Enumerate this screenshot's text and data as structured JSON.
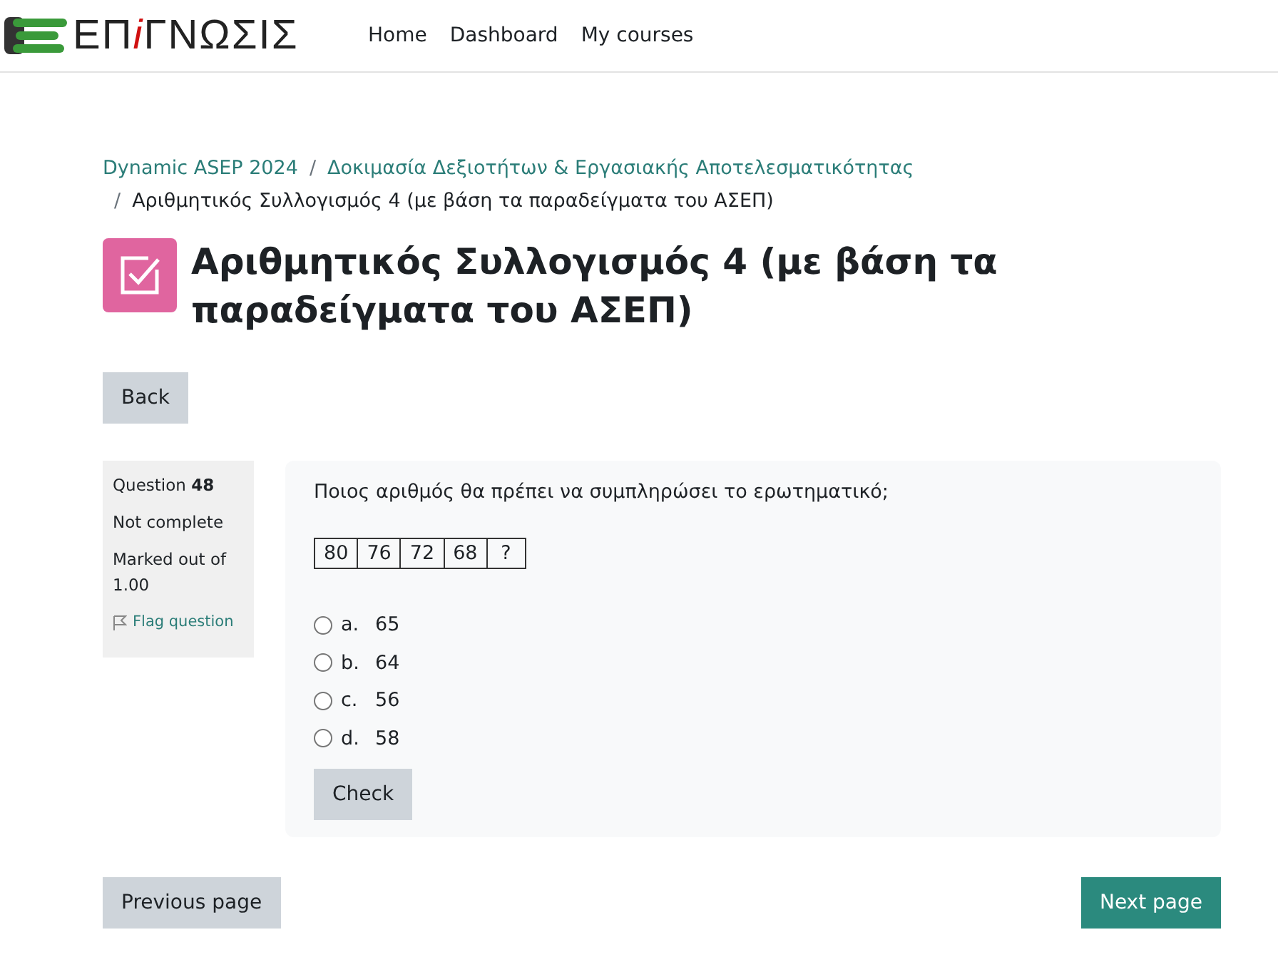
{
  "logo": {
    "parts": [
      {
        "text": "ΕΠ",
        "accent": false
      },
      {
        "text": "i",
        "accent": true
      },
      {
        "text": "ΓΝΩΣΙΣ",
        "accent": false
      }
    ]
  },
  "nav": [
    {
      "label": "Home"
    },
    {
      "label": "Dashboard"
    },
    {
      "label": "My courses"
    }
  ],
  "breadcrumb": [
    {
      "label": "Dynamic ASEP 2024",
      "kind": "link"
    },
    {
      "separator": "/",
      "label": "Δοκιμασία Δεξιοτήτων & Εργασιακής Αποτελεσματικότητας",
      "kind": "link"
    },
    {
      "separator": "/",
      "label": "Αριθμητικός Συλλογισμός 4 (με βάση τα παραδείγματα του ΑΣΕΠ)",
      "kind": "current"
    }
  ],
  "page_title": "Αριθμητικός Συλλογισμός 4 (με βάση τα παραδείγματα του ΑΣΕΠ)",
  "back_button": "Back",
  "question_info": {
    "number": "Question **48**",
    "state": "Not complete",
    "mark": "Marked out of 1.00",
    "flag": "Flag question"
  },
  "question": {
    "text": "Ποιος αριθμός θα πρέπει να συμπληρώσει το ερωτηματικό;",
    "sequence": [
      "80",
      "76",
      "72",
      "68",
      "?"
    ],
    "options": [
      {
        "letter": "a.",
        "value": "65",
        "selected": false
      },
      {
        "letter": "b.",
        "value": "64",
        "selected": false
      },
      {
        "letter": "c.",
        "value": "56",
        "selected": false
      },
      {
        "letter": "d.",
        "value": "58",
        "selected": false
      }
    ],
    "check_button": "Check"
  },
  "previous_button": "Previous page",
  "next_button": "Next page"
}
